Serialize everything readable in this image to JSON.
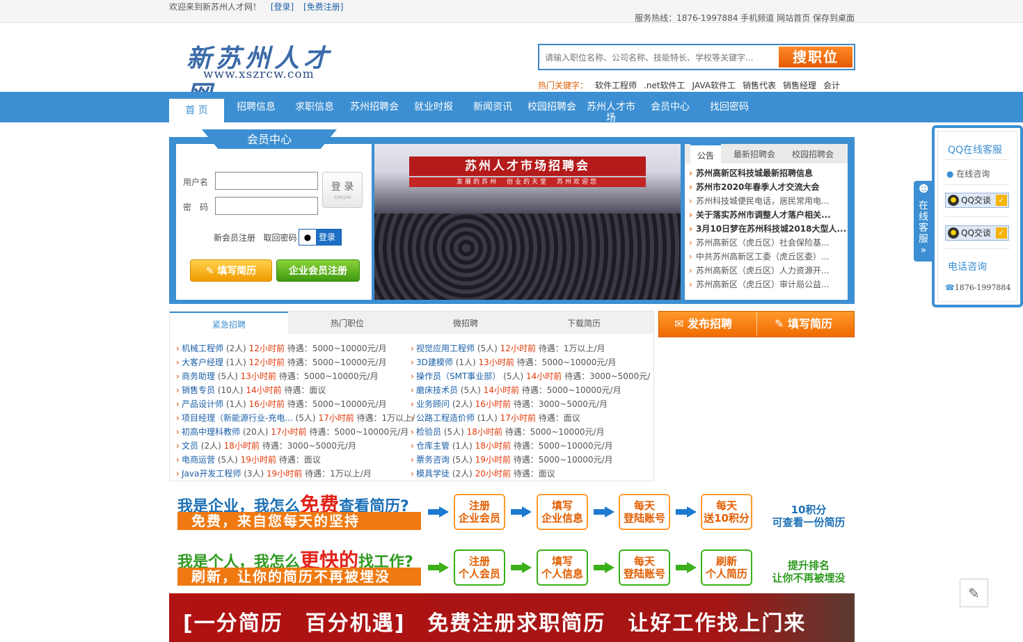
{
  "topbar": {
    "welcome": "欢迎来到新苏州人才网！",
    "login": "[登录]",
    "register": "[免费注册]",
    "hotline": "服务热线：1876-1997884",
    "mobile": "手机频道",
    "home": "网站首页",
    "save": "保存到桌面"
  },
  "logo": {
    "cn": "新苏州人才网",
    "en": "www.xszrcw.com"
  },
  "search": {
    "placeholder": "请输入职位名称、公司名称、技能特长、学校等关键字...",
    "button": "搜职位"
  },
  "hot": {
    "label": "热门关键字：",
    "words": [
      "软件工程师",
      ".net软件工",
      "JAVA软件工",
      "销售代表",
      "销售经理",
      "会计"
    ]
  },
  "nav": [
    "首 页",
    "招聘信息",
    "求职信息",
    "苏州招聘会",
    "就业时报",
    "新闻资讯",
    "校园招聘会",
    "苏州人才市场",
    "会员中心",
    "找回密码"
  ],
  "member": {
    "tag": "会员中心",
    "username_label": "用户名",
    "password_label": "密　码",
    "login_btn": "登 录",
    "login_btn_sub": "SINGIN",
    "new_reg": "新会员注册",
    "retrieve": "取回密码",
    "qq_login": "登录",
    "resume_btn": "填写简历",
    "company_btn": "企业会员注册"
  },
  "banner": {
    "title": "苏州人才市场招聘会",
    "sub": "发展的苏州　创业的天堂　苏州欢迎您"
  },
  "notice": {
    "tabs": [
      "公告",
      "最新招聘会",
      "校园招聘会"
    ],
    "items": [
      {
        "t": "苏州高新区科技城最新招聘信息",
        "b": true
      },
      {
        "t": "苏州市2020年春季人才交流大会",
        "b": true
      },
      {
        "t": "苏州科技城便民电话，居民常用电...",
        "b": false
      },
      {
        "t": "关于落实苏州市调整人才落户相关...",
        "b": true
      },
      {
        "t": "3月10日梦在苏州科技城2018大型人...",
        "b": true
      },
      {
        "t": "苏州高新区（虎丘区）社会保险基...",
        "b": false
      },
      {
        "t": "中共苏州高新区工委（虎丘区委）...",
        "b": false
      },
      {
        "t": "苏州高新区（虎丘区）人力资源开...",
        "b": false
      },
      {
        "t": "苏州高新区（虎丘区）审计局公益...",
        "b": false
      }
    ]
  },
  "jobtabs": [
    "紧急招聘",
    "热门职位",
    "微招聘",
    "下载简历"
  ],
  "jobs_left": [
    {
      "t": "机械工程师",
      "n": "(2人)",
      "h": "12小时前",
      "p": "待遇：5000~10000元/月"
    },
    {
      "t": "大客户经理",
      "n": "(1人)",
      "h": "12小时前",
      "p": "待遇：5000~10000元/月"
    },
    {
      "t": "商务助理",
      "n": "(5人)",
      "h": "13小时前",
      "p": "待遇：5000~10000元/月"
    },
    {
      "t": "销售专员",
      "n": "(10人)",
      "h": "14小时前",
      "p": "待遇：面议"
    },
    {
      "t": "产品设计师",
      "n": "(1人)",
      "h": "16小时前",
      "p": "待遇：5000~10000元/月"
    },
    {
      "t": "项目经理（新能源行业-充电...",
      "n": "(5人)",
      "h": "17小时前",
      "p": "待遇：1万以上/"
    },
    {
      "t": "初高中理科教师",
      "n": "(20人)",
      "h": "17小时前",
      "p": "待遇：5000~10000元/月"
    },
    {
      "t": "文员",
      "n": "(2人)",
      "h": "18小时前",
      "p": "待遇：3000~5000元/月"
    },
    {
      "t": "电商运营",
      "n": "(5人)",
      "h": "19小时前",
      "p": "待遇：面议"
    },
    {
      "t": "Java开发工程师",
      "n": "(3人)",
      "h": "19小时前",
      "p": "待遇：1万以上/月"
    }
  ],
  "jobs_right": [
    {
      "t": "视觉应用工程师",
      "n": "(5人)",
      "h": "12小时前",
      "p": "待遇：1万以上/月"
    },
    {
      "t": "3D建模师",
      "n": "(1人)",
      "h": "13小时前",
      "p": "待遇：5000~10000元/月"
    },
    {
      "t": "操作员（SMT事业部）",
      "n": "(5人)",
      "h": "14小时前",
      "p": "待遇：3000~5000元/"
    },
    {
      "t": "磨床技术员",
      "n": "(5人)",
      "h": "14小时前",
      "p": "待遇：5000~10000元/月"
    },
    {
      "t": "业务顾问",
      "n": "(2人)",
      "h": "16小时前",
      "p": "待遇：3000~5000元/月"
    },
    {
      "t": "公路工程造价师",
      "n": "(1人)",
      "h": "17小时前",
      "p": "待遇：面议"
    },
    {
      "t": "检验员",
      "n": "(5人)",
      "h": "18小时前",
      "p": "待遇：5000~10000元/月"
    },
    {
      "t": "仓库主管",
      "n": "(1人)",
      "h": "18小时前",
      "p": "待遇：5000~10000元/月"
    },
    {
      "t": "票务咨询",
      "n": "(5人)",
      "h": "19小时前",
      "p": "待遇：5000~10000元/月"
    },
    {
      "t": "模具学徒",
      "n": "(2人)",
      "h": "20小时前",
      "p": "待遇：面议"
    }
  ],
  "actions": {
    "publish": "发布招聘",
    "resume": "填写简历"
  },
  "strip1": {
    "h_pre": "我是企业，我怎么",
    "h_big": "免费",
    "h_post": "查看简历?",
    "bar": "免费，来自您每天的坚持",
    "steps": [
      "注册\n企业会员",
      "填写\n企业信息",
      "每天\n登陆账号",
      "每天\n送10积分"
    ],
    "final": "10积分\n可查看一份简历"
  },
  "strip2": {
    "h_pre": "我是个人，我怎么",
    "h_big": "更快的",
    "h_post": "找工作?",
    "bar": "刷新，让你的简历不再被埋没",
    "steps": [
      "注册\n个人会员",
      "填写\n个人信息",
      "每天\n登陆账号",
      "刷新\n个人简历"
    ],
    "final": "提升排名\n让你不再被埋没"
  },
  "bottom_banner": "[一分简历　百分机遇]　免费注册求职简历　让好工作找上门来",
  "qq": {
    "title": "QQ在线客服",
    "consult": "在线咨询",
    "btn": "QQ交谈",
    "phone_title": "电话咨询",
    "phone": "1876-1997884",
    "tab": "在线客服"
  },
  "colors": {
    "primary": "#3c8fd2",
    "orange": "#f06a00",
    "red_time": "#e23a0a"
  }
}
